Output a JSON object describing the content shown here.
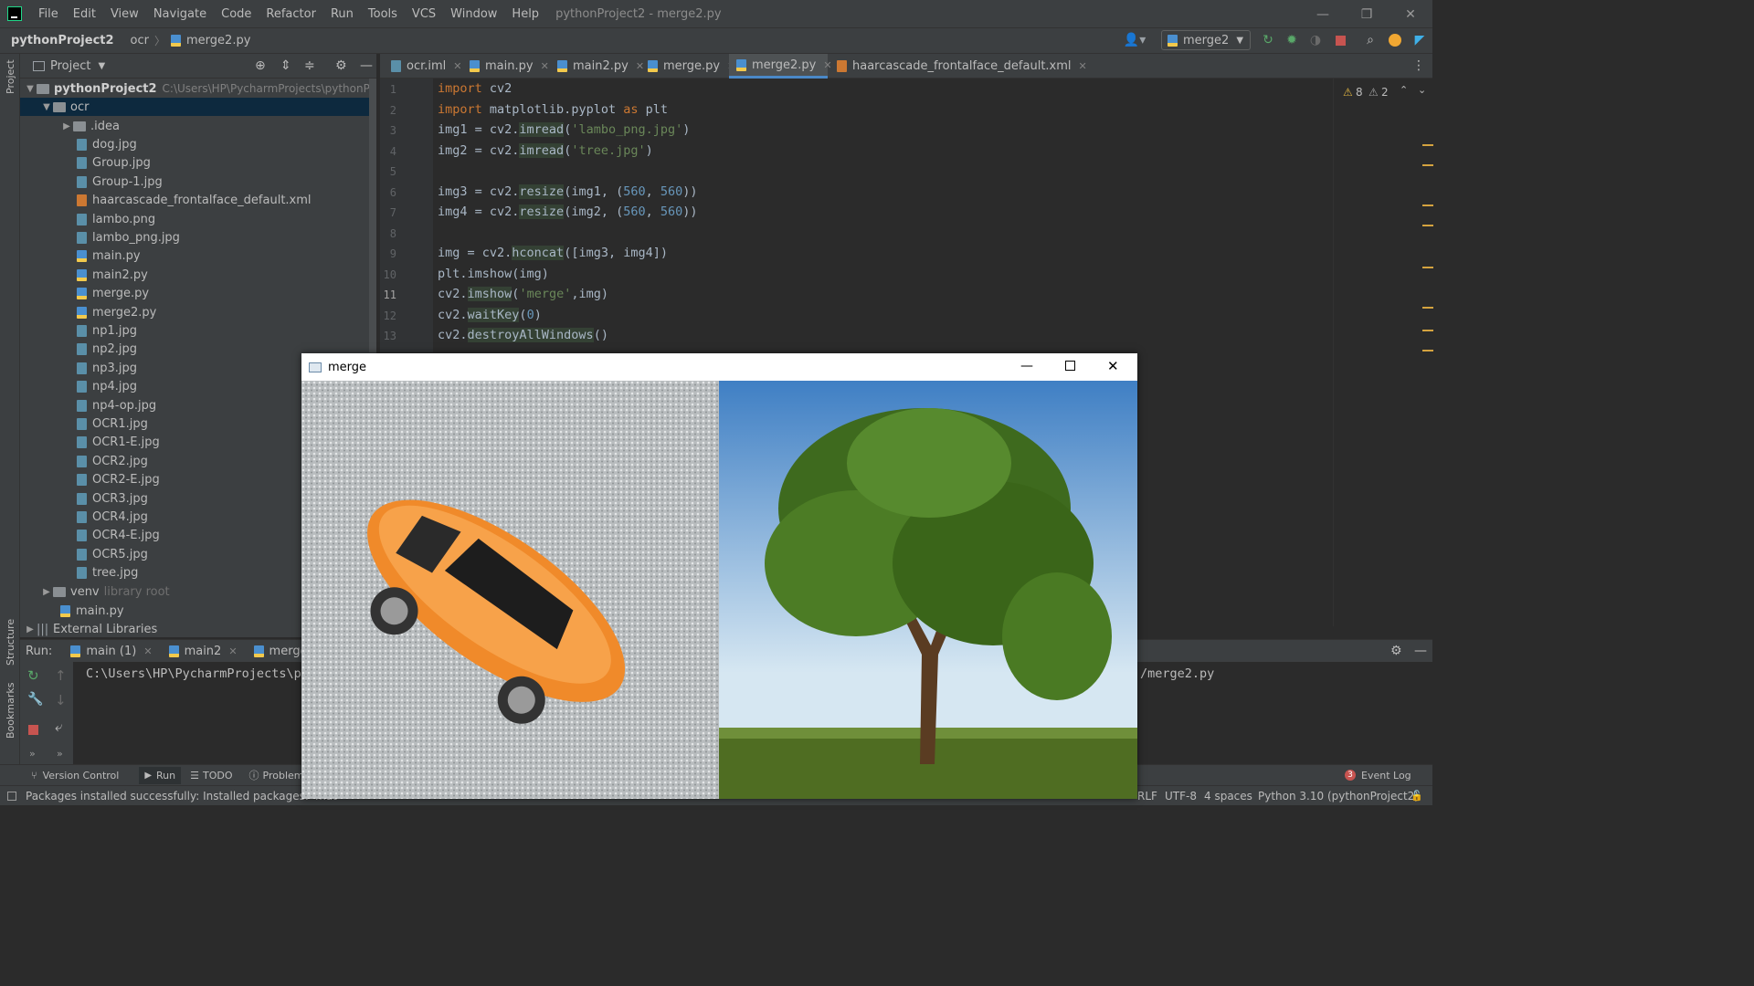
{
  "menubar": {
    "items": [
      "File",
      "Edit",
      "View",
      "Navigate",
      "Code",
      "Refactor",
      "Run",
      "Tools",
      "VCS",
      "Window",
      "Help"
    ],
    "window_title": "pythonProject2 - merge2.py"
  },
  "navbar": {
    "project": "pythonProject2",
    "folder": "ocr",
    "file": "merge2.py",
    "run_config": "merge2"
  },
  "project_panel": {
    "title": "Project",
    "root": "pythonProject2",
    "root_path": "C:\\Users\\HP\\PycharmProjects\\pythonProject2",
    "folder": "ocr",
    "files": [
      ".idea",
      "dog.jpg",
      "Group.jpg",
      "Group-1.jpg",
      "haarcascade_frontalface_default.xml",
      "lambo.png",
      "lambo_png.jpg",
      "main.py",
      "main2.py",
      "merge.py",
      "merge2.py",
      "np1.jpg",
      "np2.jpg",
      "np3.jpg",
      "np4.jpg",
      "np4-op.jpg",
      "OCR1.jpg",
      "OCR1-E.jpg",
      "OCR2.jpg",
      "OCR2-E.jpg",
      "OCR3.jpg",
      "OCR4.jpg",
      "OCR4-E.jpg",
      "OCR5.jpg",
      "tree.jpg"
    ],
    "venv": "venv",
    "venv_tag": "library root",
    "root_main": "main.py",
    "external": "External Libraries"
  },
  "editor": {
    "tabs": [
      "ocr.iml",
      "main.py",
      "main2.py",
      "merge.py",
      "merge2.py",
      "haarcascade_frontalface_default.xml"
    ],
    "active_tab": "merge2.py",
    "warnings": "8",
    "weak_warnings": "2",
    "lines": [
      "import cv2",
      "import matplotlib.pyplot as plt",
      "img1 = cv2.imread('lambo_png.jpg')",
      "img2 = cv2.imread('tree.jpg')",
      "",
      "img3 = cv2.resize(img1, (560, 560))",
      "img4 = cv2.resize(img2, (560, 560))",
      "",
      "img = cv2.hconcat([img3, img4])",
      "plt.imshow(img)",
      "cv2.imshow('merge',img)",
      "cv2.waitKey(0)",
      "cv2.destroyAllWindows()"
    ]
  },
  "run_panel": {
    "label": "Run:",
    "tabs": [
      "main (1)",
      "main2",
      "merge2"
    ],
    "output_left": "C:\\Users\\HP\\PycharmProjects\\p",
    "output_right": "/merge2.py"
  },
  "bottom_tools": [
    "Version Control",
    "Run",
    "TODO",
    "Problems",
    "Event Log"
  ],
  "event_count": "3",
  "status": {
    "message": "Packages installed successfully: Installed packages: 'mat",
    "line_sep": "RLF",
    "encoding": "UTF-8",
    "indent": "4 spaces",
    "interpreter": "Python 3.10 (pythonProject2)"
  },
  "merge_window": {
    "title": "merge"
  },
  "side_labels": {
    "project": "Project",
    "structure": "Structure",
    "bookmarks": "Bookmarks"
  }
}
